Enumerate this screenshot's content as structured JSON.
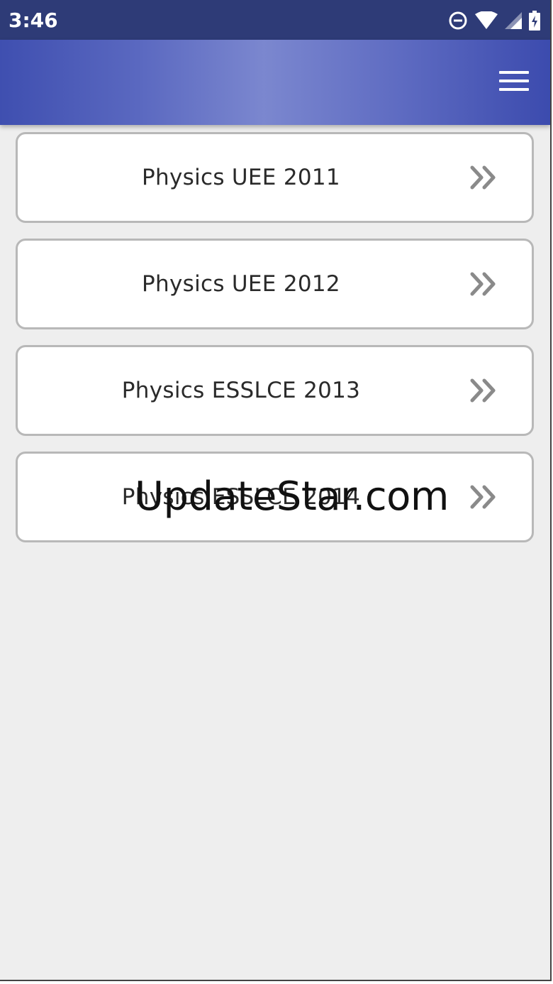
{
  "status_bar": {
    "time": "3:46",
    "icons": [
      "do-not-disturb-icon",
      "wifi-icon",
      "cell-signal-icon",
      "battery-charging-icon"
    ]
  },
  "app_bar": {
    "menu_icon": "hamburger-menu-icon"
  },
  "list": {
    "items": [
      {
        "label": "Physics  UEE 2011",
        "icon": "double-chevron-right-icon"
      },
      {
        "label": "Physics  UEE 2012",
        "icon": "double-chevron-right-icon"
      },
      {
        "label": "Physics  ESSLCE 2013",
        "icon": "double-chevron-right-icon"
      },
      {
        "label": "Physics  ESSLCE 2014",
        "icon": "double-chevron-right-icon"
      }
    ]
  },
  "watermark": {
    "text": "UpdateStar.com"
  },
  "colors": {
    "status_bar": "#2e3b77",
    "app_bar_accent": "#5a68c0",
    "background": "#eeeeee",
    "card_border": "#b8b8b8",
    "arrow": "#8a8a8a"
  }
}
